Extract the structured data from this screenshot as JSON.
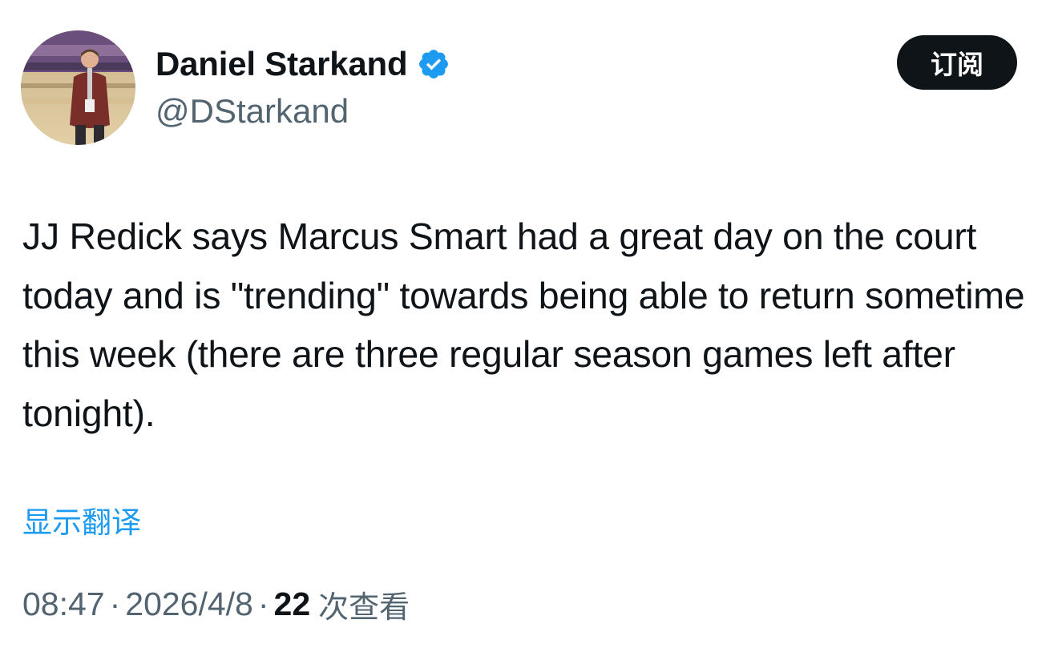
{
  "author": {
    "display_name": "Daniel Starkand",
    "handle": "@DStarkand",
    "verified": true
  },
  "subscribe_button": {
    "label": "订阅"
  },
  "tweet": {
    "text": "JJ Redick says Marcus Smart had a great day on the court today and is \"trending\" towards being able to return sometime this week (there are three regular season games left after tonight)."
  },
  "translate_link": {
    "label": "显示翻译"
  },
  "meta": {
    "time": "08:47",
    "separator": "·",
    "date": "2026/4/8",
    "views_count": "22",
    "views_label": "次查看"
  },
  "icons": {
    "verified": "verified-badge-icon"
  },
  "colors": {
    "text_primary": "#0f1419",
    "text_secondary": "#536471",
    "link": "#1d9bf0",
    "verified": "#1d9bf0",
    "button_bg": "#0f1419",
    "button_text": "#ffffff"
  }
}
